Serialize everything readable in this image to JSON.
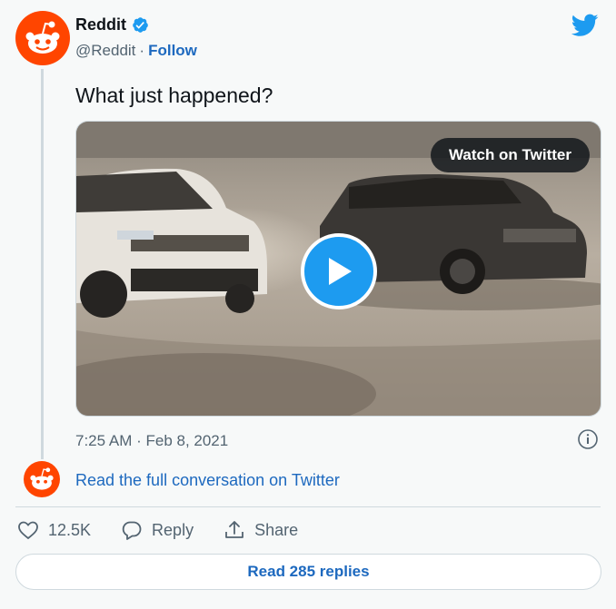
{
  "account": {
    "name": "Reddit",
    "handle": "@Reddit",
    "separator": "·",
    "follow_label": "Follow"
  },
  "tweet": {
    "text": "What just happened?",
    "timestamp": "7:25 AM · Feb 8, 2021"
  },
  "media": {
    "watch_label": "Watch on Twitter"
  },
  "conversation": {
    "link_label": "Read the full conversation on Twitter"
  },
  "actions": {
    "likes": "12.5K",
    "reply_label": "Reply",
    "share_label": "Share"
  },
  "replies_button": "Read 285 replies",
  "colors": {
    "reddit_orange": "#ff4500",
    "twitter_blue": "#1d9bf0",
    "link_blue": "#1d69bf"
  }
}
